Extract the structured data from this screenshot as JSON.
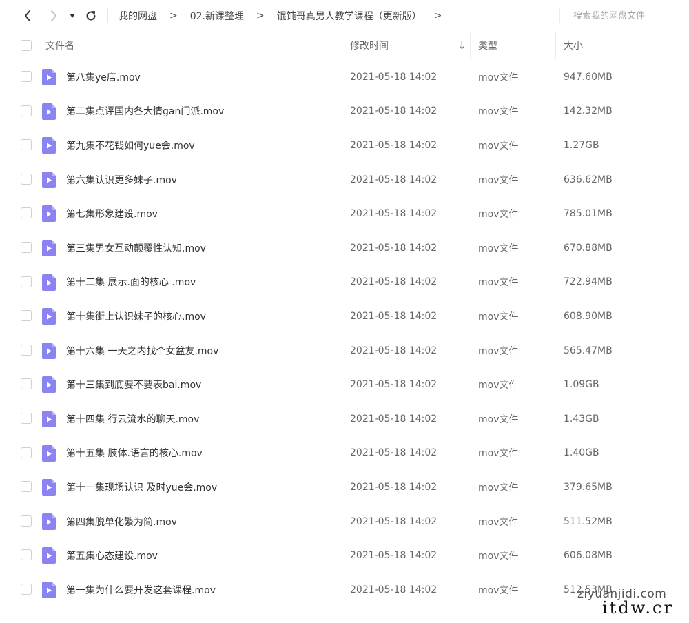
{
  "search": {
    "placeholder": "搜索我的网盘文件"
  },
  "breadcrumb": [
    "我的网盘",
    "02.新课整理",
    "馄饨哥真男人教学课程（更新版）"
  ],
  "breadcrumb_separator": ">",
  "columns": {
    "name": "文件名",
    "time": "修改时间",
    "type": "类型",
    "size": "大小",
    "sort_indicator": "↓"
  },
  "colors": {
    "accent": "#1e88e5",
    "file_icon": "#8c83f2"
  },
  "files": [
    {
      "name": "第八集ye店.mov",
      "time": "2021-05-18 14:02",
      "type": "mov文件",
      "size": "947.60MB"
    },
    {
      "name": "第二集点评国内各大情gan门派.mov",
      "time": "2021-05-18 14:02",
      "type": "mov文件",
      "size": "142.32MB"
    },
    {
      "name": "第九集不花钱如何yue会.mov",
      "time": "2021-05-18 14:02",
      "type": "mov文件",
      "size": "1.27GB"
    },
    {
      "name": "第六集认识更多妹子.mov",
      "time": "2021-05-18 14:02",
      "type": "mov文件",
      "size": "636.62MB"
    },
    {
      "name": "第七集形象建设.mov",
      "time": "2021-05-18 14:02",
      "type": "mov文件",
      "size": "785.01MB"
    },
    {
      "name": "第三集男女互动颠覆性认知.mov",
      "time": "2021-05-18 14:02",
      "type": "mov文件",
      "size": "670.88MB"
    },
    {
      "name": "第十二集 展示.面的核心 .mov",
      "time": "2021-05-18 14:02",
      "type": "mov文件",
      "size": "722.94MB"
    },
    {
      "name": "第十集街上认识妹子的核心.mov",
      "time": "2021-05-18 14:02",
      "type": "mov文件",
      "size": "608.90MB"
    },
    {
      "name": "第十六集 一天之内找个女盆友.mov",
      "time": "2021-05-18 14:02",
      "type": "mov文件",
      "size": "565.47MB"
    },
    {
      "name": "第十三集到底要不要表bai.mov",
      "time": "2021-05-18 14:02",
      "type": "mov文件",
      "size": "1.09GB"
    },
    {
      "name": "第十四集 行云流水的聊天.mov",
      "time": "2021-05-18 14:02",
      "type": "mov文件",
      "size": "1.43GB"
    },
    {
      "name": "第十五集 肢体.语言的核心.mov",
      "time": "2021-05-18 14:02",
      "type": "mov文件",
      "size": "1.40GB"
    },
    {
      "name": "第十一集现场认识 及时yue会.mov",
      "time": "2021-05-18 14:02",
      "type": "mov文件",
      "size": "379.65MB"
    },
    {
      "name": "第四集脱单化繁为简.mov",
      "time": "2021-05-18 14:02",
      "type": "mov文件",
      "size": "511.52MB"
    },
    {
      "name": "第五集心态建设.mov",
      "time": "2021-05-18 14:02",
      "type": "mov文件",
      "size": "606.08MB"
    },
    {
      "name": "第一集为什么要开发这套课程.mov",
      "time": "2021-05-18 14:02",
      "type": "mov文件",
      "size": "512.53MB"
    }
  ],
  "watermark": {
    "line1": "ziyuanjidi.com",
    "line2": "itdw.cr"
  }
}
